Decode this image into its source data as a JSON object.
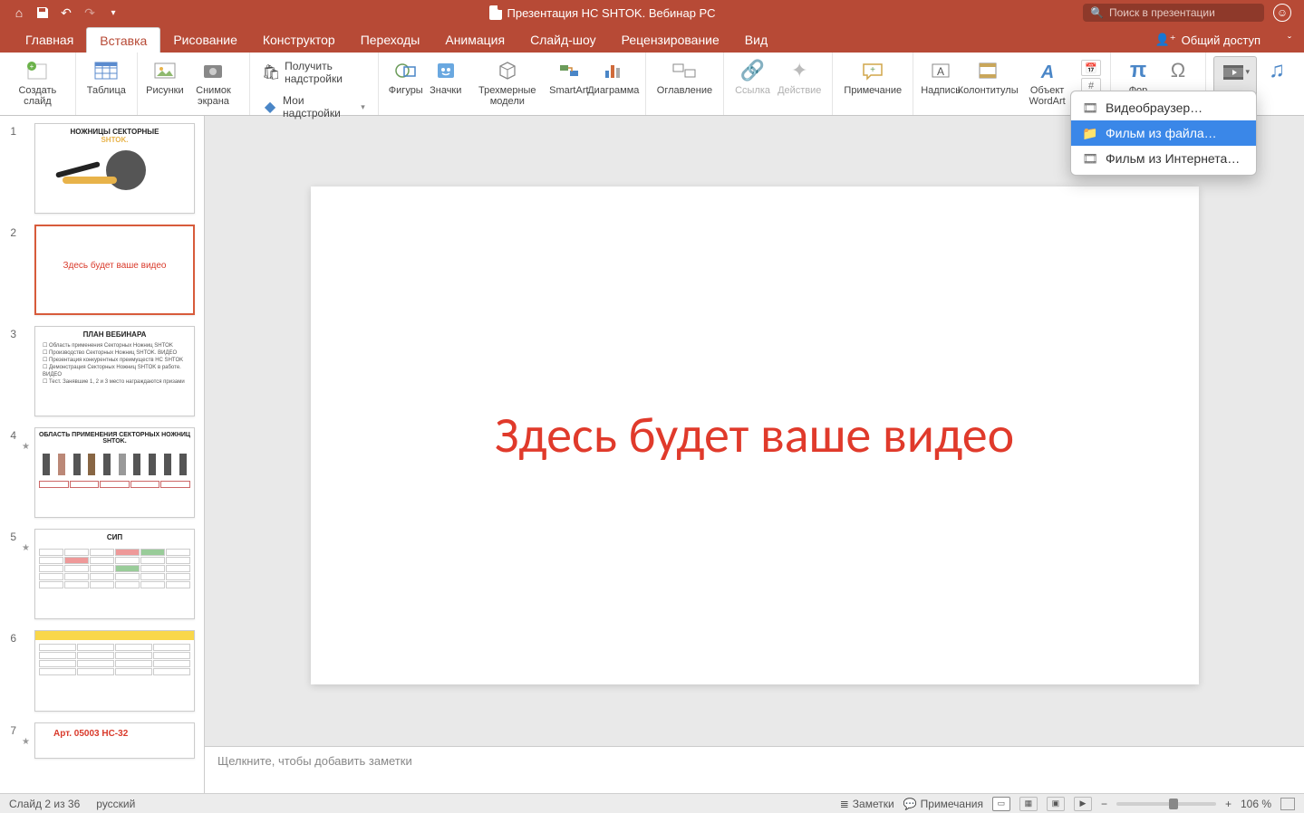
{
  "titlebar": {
    "doc_title": "Презентация НС SHTOK. Вебинар РС",
    "search_placeholder": "Поиск в презентации"
  },
  "tabs": {
    "items": [
      "Главная",
      "Вставка",
      "Рисование",
      "Конструктор",
      "Переходы",
      "Анимация",
      "Слайд-шоу",
      "Рецензирование",
      "Вид"
    ],
    "active_index": 1,
    "share_label": "Общий доступ"
  },
  "ribbon": {
    "new_slide": "Создать слайд",
    "table": "Таблица",
    "pictures": "Рисунки",
    "screenshot": "Снимок экрана",
    "get_addins": "Получить надстройки",
    "my_addins": "Мои надстройки",
    "shapes": "Фигуры",
    "icons": "Значки",
    "models3d": "Трехмерные модели",
    "smartart": "SmartArt",
    "chart": "Диаграмма",
    "contents": "Оглавление",
    "link": "Ссылка",
    "action": "Действие",
    "comment": "Примечание",
    "textbox": "Надпись",
    "headerfooter": "Колонтитулы",
    "wordart": "Объект WordArt",
    "equation_partial": "Фор"
  },
  "dropdown": {
    "item1": "Видеобраузер…",
    "item2": "Фильм из файла…",
    "item3": "Фильм из Интернета…"
  },
  "thumbs": {
    "s1_title": "НОЖНИЦЫ СЕКТОРНЫЕ",
    "s1_brand": "SHTOK.",
    "s2_text": "Здесь будет ваше видео",
    "s3_title": "ПЛАН ВЕБИНАРА",
    "s3_l1": "Область применения Секторных Ножниц SHTOK",
    "s3_l2": "Производство Секторных Ножниц SHTOK. ВИДЕО",
    "s3_l3": "Презентация конкурентных преимуществ НС SHTOK",
    "s3_l4": "Демонстрация Секторных Ножниц SHTOK в работе. ВИДЕО",
    "s3_l5": "Тест. Занявшие 1, 2 и 3 место награждаются призами",
    "s4_title": "ОБЛАСТЬ ПРИМЕНЕНИЯ СЕКТОРНЫХ НОЖНИЦ SHTOK.",
    "s5_title": "СИП",
    "s7_art": "Арт. 05003 НС-32"
  },
  "canvas": {
    "main_text": "Здесь будет ваше видео"
  },
  "notes": {
    "placeholder": "Щелкните, чтобы добавить заметки"
  },
  "statusbar": {
    "slide_info": "Слайд 2 из 36",
    "language": "русский",
    "notes_btn": "Заметки",
    "comments_btn": "Примечания",
    "zoom": "106 %"
  }
}
